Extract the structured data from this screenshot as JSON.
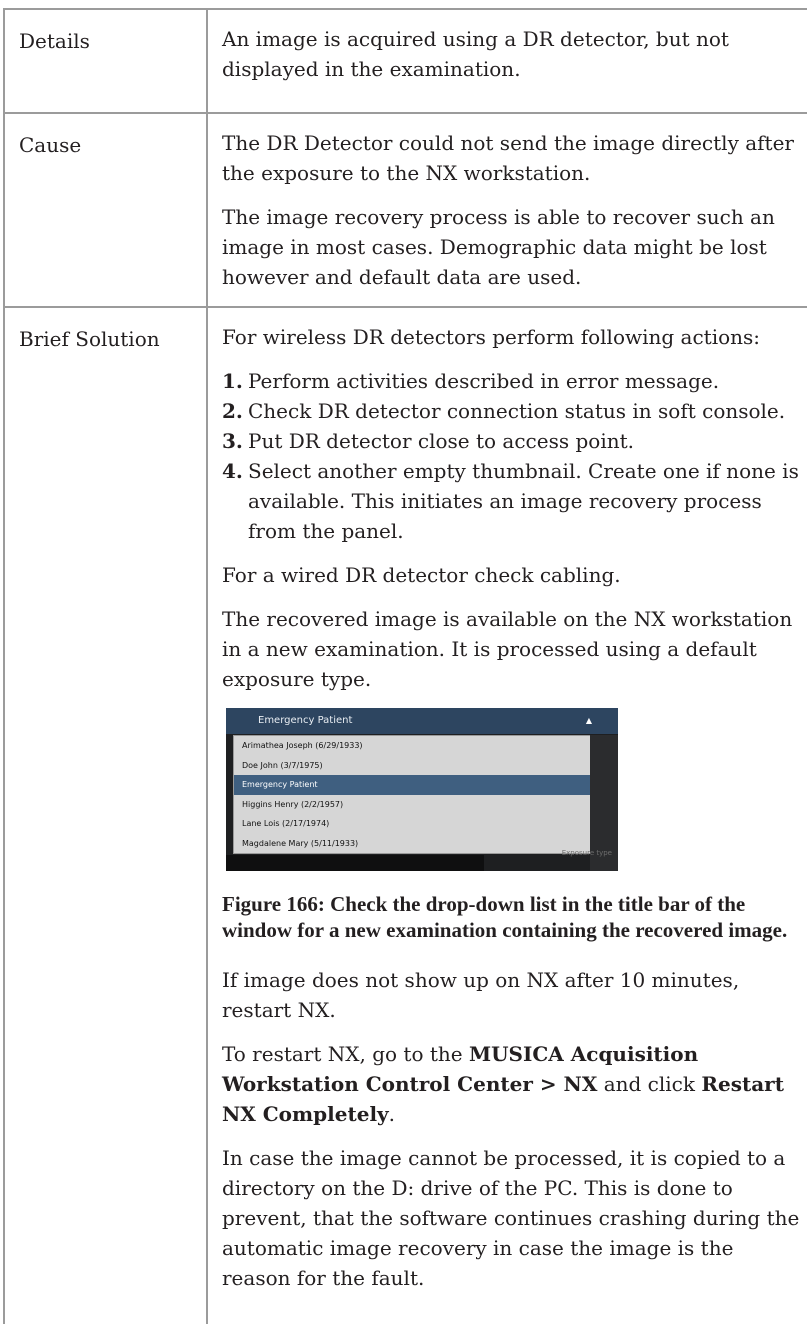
{
  "rows": {
    "details": {
      "label": "Details",
      "text": "An image is acquired using a DR detector, but not displayed in the examination."
    },
    "cause": {
      "label": "Cause",
      "p1": "The DR Detector could not send the image directly after the exposure to the NX workstation.",
      "p2": "The image recovery process is able to recover such an image in most cases. Demographic data might be lost however and default data are used."
    },
    "solution": {
      "label": "Brief Solution",
      "intro": "For wireless DR detectors perform following actions:",
      "steps": [
        {
          "num": "1.",
          "text": "Perform activities described in error message."
        },
        {
          "num": "2.",
          "text": "Check DR detector connection status in soft console."
        },
        {
          "num": "3.",
          "text": "Put DR detector close to access point."
        },
        {
          "num": "4.",
          "text": "Select another empty thumbnail. Create one if none is available. This initiates an image recovery process from the panel."
        }
      ],
      "wired": "For a wired DR detector check cabling.",
      "recovered": "The recovered image is available on the NX workstation in a new examination. It is processed using a default exposure type.",
      "figure": {
        "title_bar": "Emergency Patient",
        "arrow": "▲",
        "items": [
          "Arimathea Joseph (6/29/1933)",
          "Doe John (3/7/1975)",
          "Emergency Patient",
          "Higgins Henry (2/2/1957)",
          "Lane Lois (2/17/1974)",
          "Magdalene Mary (5/11/1933)"
        ],
        "footer": "Exposure type"
      },
      "caption": "Figure 166: Check the drop-down list in the title bar of the window for a new examination containing the recovered image.",
      "notshow": "If image does not show up on NX after 10 minutes, restart NX.",
      "restart": {
        "pre": "To restart NX, go to the ",
        "b1": "MUSICA Acquisition Workstation Control Center",
        "sep": " > ",
        "b2": "NX",
        "mid": " and click ",
        "b3": "Restart NX Completely",
        "end": "."
      },
      "incase": "In case the image cannot be processed, it is copied to a directory on the D: drive of the PC. This is done to prevent, that the software continues crashing during the automatic image recovery in case the image is the reason for the fault."
    }
  }
}
